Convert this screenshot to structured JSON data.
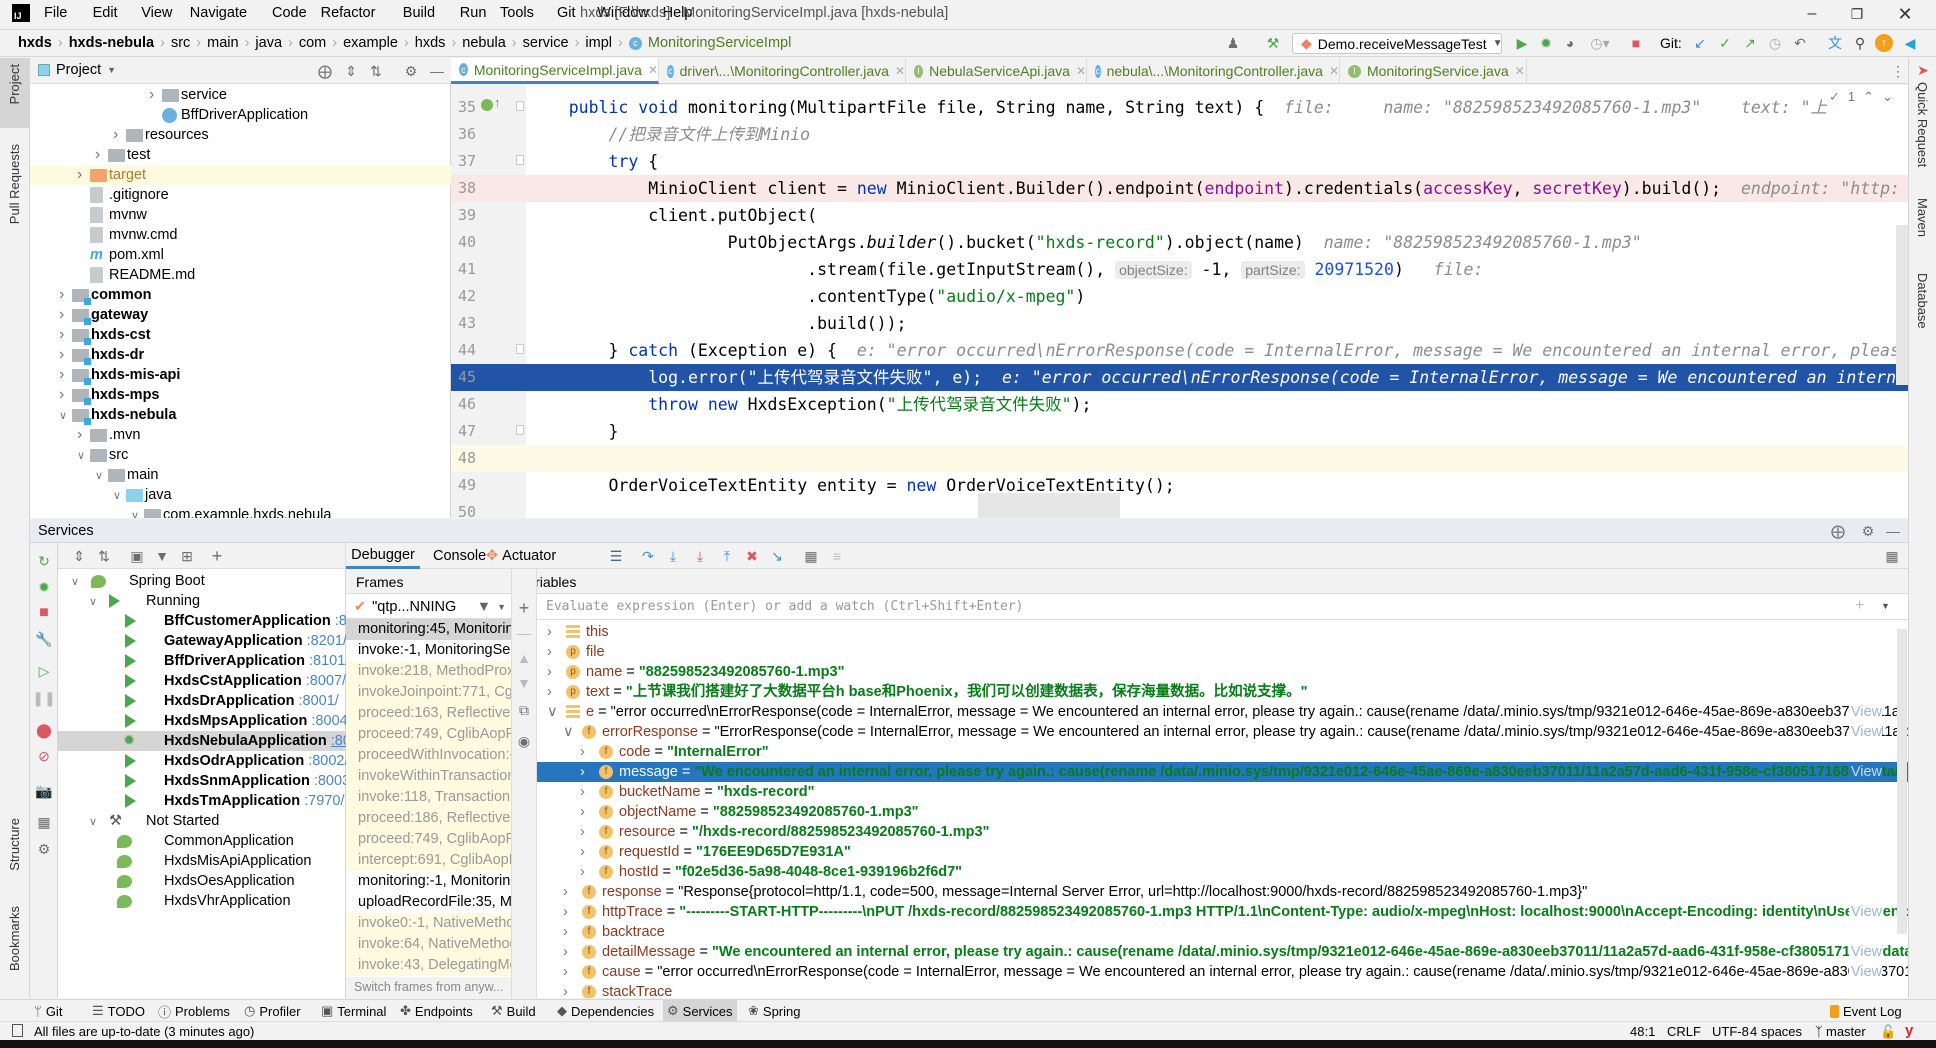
{
  "menubar": {
    "items": [
      "File",
      "Edit",
      "View",
      "Navigate",
      "Code",
      "Refactor",
      "Build",
      "Run",
      "Tools",
      "Git",
      "Window",
      "Help"
    ],
    "title": "hxds [F:\\hxds] - MonitoringServiceImpl.java [hxds-nebula]"
  },
  "breadcrumb": [
    "hxds",
    "hxds-nebula",
    "src",
    "main",
    "java",
    "com",
    "example",
    "hxds",
    "nebula",
    "service",
    "impl",
    "MonitoringServiceImpl"
  ],
  "toolbar": {
    "run_config": "Demo.receiveMessageTest",
    "git_label": "Git:"
  },
  "editor_tabs": [
    {
      "label": "MonitoringServiceImpl.java",
      "kind": "C",
      "active": true
    },
    {
      "label": "driver\\...\\MonitoringController.java",
      "kind": "C"
    },
    {
      "label": "NebulaServiceApi.java",
      "kind": "I"
    },
    {
      "label": "nebula\\...\\MonitoringController.java",
      "kind": "C"
    },
    {
      "label": "MonitoringService.java",
      "kind": "I"
    }
  ],
  "project_panel": {
    "title": "Project",
    "items": [
      {
        "label": "service",
        "depth": 5,
        "arrow": "right",
        "icon": "folder"
      },
      {
        "label": "BffDriverApplication",
        "depth": 5,
        "arrow": "",
        "icon": "spring-class"
      },
      {
        "label": "resources",
        "depth": 3,
        "arrow": "right",
        "icon": "folder"
      },
      {
        "label": "test",
        "depth": 2,
        "arrow": "right",
        "icon": "folder"
      },
      {
        "label": "target",
        "depth": 1,
        "arrow": "right",
        "icon": "folder-orange",
        "highlight": true
      },
      {
        "label": ".gitignore",
        "depth": 1,
        "arrow": "",
        "icon": "file"
      },
      {
        "label": "mvnw",
        "depth": 1,
        "arrow": "",
        "icon": "file"
      },
      {
        "label": "mvnw.cmd",
        "depth": 1,
        "arrow": "",
        "icon": "file"
      },
      {
        "label": "pom.xml",
        "depth": 1,
        "arrow": "",
        "icon": "maven"
      },
      {
        "label": "README.md",
        "depth": 1,
        "arrow": "",
        "icon": "file"
      },
      {
        "label": "common",
        "depth": 0,
        "arrow": "right",
        "icon": "module",
        "bold": true
      },
      {
        "label": "gateway",
        "depth": 0,
        "arrow": "right",
        "icon": "module",
        "bold": true
      },
      {
        "label": "hxds-cst",
        "depth": 0,
        "arrow": "right",
        "icon": "module",
        "bold": true
      },
      {
        "label": "hxds-dr",
        "depth": 0,
        "arrow": "right",
        "icon": "module",
        "bold": true
      },
      {
        "label": "hxds-mis-api",
        "depth": 0,
        "arrow": "right",
        "icon": "module",
        "bold": true
      },
      {
        "label": "hxds-mps",
        "depth": 0,
        "arrow": "right",
        "icon": "module",
        "bold": true
      },
      {
        "label": "hxds-nebula",
        "depth": 0,
        "arrow": "down",
        "icon": "module",
        "bold": true
      },
      {
        "label": ".mvn",
        "depth": 1,
        "arrow": "right",
        "icon": "folder"
      },
      {
        "label": "src",
        "depth": 1,
        "arrow": "down",
        "icon": "folder"
      },
      {
        "label": "main",
        "depth": 2,
        "arrow": "down",
        "icon": "folder"
      },
      {
        "label": "java",
        "depth": 3,
        "arrow": "down",
        "icon": "folder-blue"
      },
      {
        "label": "com.example.hxds.nebula",
        "depth": 4,
        "arrow": "down",
        "icon": "folder"
      }
    ]
  },
  "code": [
    {
      "n": "35",
      "tokens": [
        [
          "    "
        ],
        [
          "public",
          "kw"
        ],
        [
          " "
        ],
        [
          "void",
          "kw"
        ],
        [
          " monitoring(MultipartFile file, String name, String text) {"
        ]
      ],
      "hint": "  file:     name: \"882598523492085760-1.mp3\"    text: \"上"
    },
    {
      "n": "36",
      "tokens": [
        [
          "        "
        ],
        [
          "//把录音文件上传到Minio",
          "cmt"
        ]
      ]
    },
    {
      "n": "37",
      "tokens": [
        [
          "        "
        ],
        [
          "try",
          "kw"
        ],
        [
          " {"
        ]
      ]
    },
    {
      "n": "38",
      "tokens": [
        [
          "            MinioClient client = "
        ],
        [
          "new",
          "kw"
        ],
        [
          " MinioClient.Builder().endpoint("
        ],
        [
          "endpoint",
          "fld"
        ],
        [
          ").credentials("
        ],
        [
          "accessKey",
          "fld"
        ],
        [
          ", "
        ],
        [
          "secretKey",
          "fld"
        ],
        [
          ").build();"
        ]
      ],
      "hint": "  endpoint: \"http:",
      "bg": "bp"
    },
    {
      "n": "39",
      "tokens": [
        [
          "            client.putObject("
        ]
      ]
    },
    {
      "n": "40",
      "tokens": [
        [
          "                    PutObjectArgs."
        ],
        [
          "builder",
          "it"
        ],
        [
          "().bucket("
        ],
        [
          "\"hxds-record\"",
          "str"
        ],
        [
          ").object(name)"
        ]
      ],
      "hint": "  name: \"882598523492085760-1.mp3\""
    },
    {
      "n": "41",
      "tokens": [
        [
          "                            .stream(file.getInputStream(), "
        ],
        [
          "objectSize:",
          "ph"
        ],
        [
          " -1, "
        ],
        [
          "partSize:",
          "ph"
        ],
        [
          " "
        ],
        [
          "20971520",
          "num"
        ],
        [
          ")"
        ]
      ],
      "hint": "   file:"
    },
    {
      "n": "42",
      "tokens": [
        [
          "                            .contentType("
        ],
        [
          "\"audio/x-mpeg\"",
          "str"
        ],
        [
          ")"
        ]
      ]
    },
    {
      "n": "43",
      "tokens": [
        [
          "                            .build());"
        ]
      ]
    },
    {
      "n": "44",
      "tokens": [
        [
          "        } "
        ],
        [
          "catch",
          "kw"
        ],
        [
          " (Exception e) {"
        ]
      ],
      "hint": "  e: \"error occurred\\nErrorResponse(code = InternalError, message = We encountered an internal error, pleas"
    },
    {
      "n": "45",
      "tokens": [
        [
          "            "
        ],
        [
          "log",
          "fld"
        ],
        [
          ".error("
        ],
        [
          "\"上传代驾录音文件失败\"",
          "str"
        ],
        [
          ", e);"
        ]
      ],
      "hint": "  e: \"error occurred\\nErrorResponse(code = InternalError, message = We encountered an interna",
      "bg": "sel"
    },
    {
      "n": "46",
      "tokens": [
        [
          "            "
        ],
        [
          "throw",
          "kw"
        ],
        [
          " "
        ],
        [
          "new",
          "kw"
        ],
        [
          " HxdsException("
        ],
        [
          "\"上传代驾录音文件失败\"",
          "str"
        ],
        [
          ");"
        ]
      ]
    },
    {
      "n": "47",
      "tokens": [
        [
          "        }"
        ]
      ]
    },
    {
      "n": "48",
      "tokens": [
        [
          ""
        ]
      ],
      "bg": "caret"
    },
    {
      "n": "49",
      "tokens": [
        [
          "        OrderVoiceTextEntity entity = "
        ],
        [
          "new",
          "kw"
        ],
        [
          " OrderVoiceTextEntity();"
        ]
      ]
    },
    {
      "n": "50",
      "tokens": [
        [
          ""
        ]
      ]
    }
  ],
  "services": {
    "title": "Services",
    "tree": [
      {
        "label": "Spring Boot",
        "level": 0,
        "arrow": "down",
        "icon": "spring"
      },
      {
        "label": "Running",
        "level": 1,
        "arrow": "down",
        "icon": "run"
      },
      {
        "label": "BffCustomerApplication",
        "port": ":8102/",
        "level": 2,
        "icon": "run",
        "bold": true
      },
      {
        "label": "GatewayApplication",
        "port": ":8201/",
        "level": 2,
        "icon": "run",
        "bold": true
      },
      {
        "label": "BffDriverApplication",
        "port": ":8101/",
        "level": 2,
        "icon": "run",
        "bold": true
      },
      {
        "label": "HxdsCstApplication",
        "port": ":8007/",
        "level": 2,
        "icon": "run",
        "bold": true
      },
      {
        "label": "HxdsDrApplication",
        "port": ":8001/",
        "level": 2,
        "icon": "run",
        "bold": true
      },
      {
        "label": "HxdsMpsApplication",
        "port": ":8004/",
        "level": 2,
        "icon": "run",
        "bold": true
      },
      {
        "label": "HxdsNebulaApplication",
        "port": ":8009/",
        "level": 2,
        "icon": "debug",
        "bold": true,
        "selected": true
      },
      {
        "label": "HxdsOdrApplication",
        "port": ":8002/",
        "level": 2,
        "icon": "run",
        "bold": true
      },
      {
        "label": "HxdsSnmApplication",
        "port": ":8003/",
        "level": 2,
        "icon": "run",
        "bold": true
      },
      {
        "label": "HxdsTmApplication",
        "port": ":7970/",
        "level": 2,
        "icon": "run",
        "bold": true
      },
      {
        "label": "Not Started",
        "level": 1,
        "arrow": "down",
        "icon": "wrench"
      },
      {
        "label": "CommonApplication",
        "level": 2,
        "icon": "spring"
      },
      {
        "label": "HxdsMisApiApplication",
        "level": 2,
        "icon": "spring"
      },
      {
        "label": "HxdsOesApplication",
        "level": 2,
        "icon": "spring"
      },
      {
        "label": "HxdsVhrApplication",
        "level": 2,
        "icon": "spring"
      }
    ],
    "tabs": [
      "Debugger",
      "Console",
      "Actuator"
    ],
    "frames_label": "Frames",
    "thread": "\"qtp...NNING",
    "frames": [
      {
        "t": "monitoring:45, Monitoring",
        "k": "cur"
      },
      {
        "t": "invoke:-1, MonitoringServi",
        "k": ""
      },
      {
        "t": "invoke:218, MethodProxy",
        "k": "lib"
      },
      {
        "t": "invokeJoinpoint:771, Cglib",
        "k": "lib"
      },
      {
        "t": "proceed:163, ReflectiveMe",
        "k": "lib"
      },
      {
        "t": "proceed:749, CglibAopPro",
        "k": "lib"
      },
      {
        "t": "proceedWithInvocation:-1,",
        "k": "lib"
      },
      {
        "t": "invokeWithinTransaction:36",
        "k": "lib"
      },
      {
        "t": "invoke:118, TransactionInte",
        "k": "lib"
      },
      {
        "t": "proceed:186, ReflectiveMe",
        "k": "lib"
      },
      {
        "t": "proceed:749, CglibAopPro",
        "k": "lib"
      },
      {
        "t": "intercept:691, CglibAopPro",
        "k": "lib"
      },
      {
        "t": "monitoring:-1, Monitoring",
        "k": ""
      },
      {
        "t": "uploadRecordFile:35, Moni",
        "k": ""
      },
      {
        "t": "invoke0:-1, NativeMethodA",
        "k": "lib"
      },
      {
        "t": "invoke:64, NativeMethodA",
        "k": "lib"
      },
      {
        "t": "invoke:43, DelegatingMeth",
        "k": "lib"
      }
    ],
    "switch_frames": "Switch frames from anyw...",
    "variables_label": "Variables",
    "eval_placeholder": "Evaluate expression (Enter) or add a watch (Ctrl+Shift+Enter)",
    "view_label": "View",
    "variables": [
      {
        "name": "this",
        "value": "",
        "level": 0,
        "icon": "list",
        "arrow": "right"
      },
      {
        "name": "file",
        "value": "",
        "level": 0,
        "icon": "p",
        "arrow": "right"
      },
      {
        "name": "name",
        "value": "\"882598523492085760-1.mp3\"",
        "level": 0,
        "icon": "p",
        "arrow": "right",
        "str": true
      },
      {
        "name": "text",
        "value": "\"上节课我们搭建好了大数据平台h base和Phoenix，我们可以创建数据表，保存海量数据。比如说支撑。\"",
        "level": 0,
        "icon": "p",
        "arrow": "right",
        "str": true
      },
      {
        "name": "e",
        "value": "\"error occurred\\nErrorResponse(code = InternalError, message = We encountered an internal error, please try again.: cause(rename /data/.minio.sys/tmp/9321e012-646e-45ae-869e-a830eeb37011/11a2a57d-aad6-4...",
        "level": 0,
        "icon": "list",
        "arrow": "down",
        "view": true
      },
      {
        "name": "errorResponse",
        "value": "\"ErrorResponse(code = InternalError, message = We encountered an internal error, please try again.: cause(rename /data/.minio.sys/tmp/9321e012-646e-45ae-869e-a830eeb37011/11a2a57d-aad6-4...",
        "level": 1,
        "icon": "f",
        "arrow": "down",
        "view": true
      },
      {
        "name": "code",
        "value": "\"InternalError\"",
        "level": 2,
        "icon": "f",
        "arrow": "right",
        "str": true
      },
      {
        "name": "message",
        "value": "\"We encountered an internal error, please try again.: cause(rename /data/.minio.sys/tmp/9321e012-646e-45ae-869e-a830eeb37011/11a2a57d-aad6-431f-958e-cf380517168a /data/hxds-record/88...",
        "level": 2,
        "icon": "f",
        "arrow": "right",
        "str": true,
        "selected": true,
        "view": true
      },
      {
        "name": "bucketName",
        "value": "\"hxds-record\"",
        "level": 2,
        "icon": "f",
        "arrow": "right",
        "str": true
      },
      {
        "name": "objectName",
        "value": "\"882598523492085760-1.mp3\"",
        "level": 2,
        "icon": "f",
        "arrow": "right",
        "str": true
      },
      {
        "name": "resource",
        "value": "\"/hxds-record/882598523492085760-1.mp3\"",
        "level": 2,
        "icon": "f",
        "arrow": "right",
        "str": true
      },
      {
        "name": "requestId",
        "value": "\"176EE9D65D7E931A\"",
        "level": 2,
        "icon": "f",
        "arrow": "right",
        "str": true
      },
      {
        "name": "hostId",
        "value": "\"f02e5d36-5a98-4048-8ce1-939196b2f6d7\"",
        "level": 2,
        "icon": "f",
        "arrow": "right",
        "str": true
      },
      {
        "name": "response",
        "value": "\"Response{protocol=http/1.1, code=500, message=Internal Server Error, url=http://localhost:9000/hxds-record/882598523492085760-1.mp3}\"",
        "level": 1,
        "icon": "f",
        "arrow": "right"
      },
      {
        "name": "httpTrace",
        "value": "\"---------START-HTTP---------\\nPUT /hxds-record/882598523492085760-1.mp3 HTTP/1.1\\nContent-Type: audio/x-mpeg\\nHost: localhost:9000\\nAccept-Encoding: identity\\nUser-Agent: MinIO (Win...",
        "level": 1,
        "icon": "f",
        "arrow": "right",
        "str": true,
        "view": true
      },
      {
        "name": "backtrace",
        "value": "",
        "level": 1,
        "icon": "f",
        "arrow": "right"
      },
      {
        "name": "detailMessage",
        "value": "\"We encountered an internal error, please try again.: cause(rename /data/.minio.sys/tmp/9321e012-646e-45ae-869e-a830eeb37011/11a2a57d-aad6-431f-958e-cf380517168a /data/hxds-record/...",
        "level": 1,
        "icon": "f",
        "arrow": "right",
        "str": true,
        "view": true
      },
      {
        "name": "cause",
        "value": "\"error occurred\\nErrorResponse(code = InternalError, message = We encountered an internal error, please try again.: cause(rename /data/.minio.sys/tmp/9321e012-646e-45ae-869e-a830eeb37011/11a2a57d-...",
        "level": 1,
        "icon": "f",
        "arrow": "right",
        "view": true
      },
      {
        "name": "stackTrace",
        "value": "",
        "level": 1,
        "icon": "f",
        "arrow": "right"
      }
    ]
  },
  "left_stripe": {
    "project": "Project",
    "pull_requests": "Pull Requests",
    "structure": "Structure",
    "bookmarks": "Bookmarks"
  },
  "right_stripe": {
    "quick_request": "Quick Request",
    "maven": "Maven",
    "database": "Database"
  },
  "bottom_tools": [
    "Git",
    "TODO",
    "Problems",
    "Profiler",
    "Terminal",
    "Endpoints",
    "Build",
    "Dependencies",
    "Services",
    "Spring"
  ],
  "bottom_active": "Services",
  "event_log": "Event Log",
  "status": {
    "message": "All files are up-to-date (3 minutes ago)",
    "position": "48:1",
    "line_sep": "CRLF",
    "encoding": "UTF-8",
    "indent": "4 spaces",
    "branch": "master"
  },
  "inspection": {
    "count": "1"
  }
}
